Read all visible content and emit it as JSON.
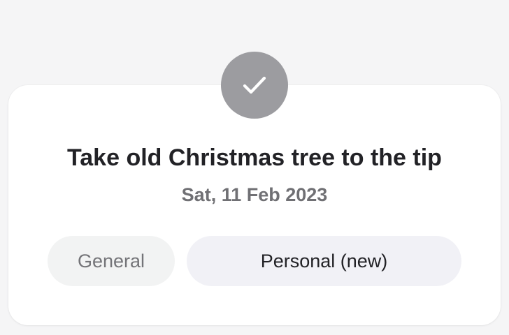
{
  "task": {
    "title": "Take old Christmas tree to the tip",
    "date": "Sat, 11 Feb 2023",
    "status_icon": "checkmark-icon"
  },
  "chips": {
    "general_label": "General",
    "personal_label": "Personal (new)"
  },
  "colors": {
    "badge": "#9c9ca0",
    "title": "#222226",
    "subtitle": "#707074",
    "chip_general_bg": "#f2f3f3",
    "chip_personal_bg": "#f1f1f6",
    "background": "#f5f5f6",
    "card": "#ffffff"
  }
}
